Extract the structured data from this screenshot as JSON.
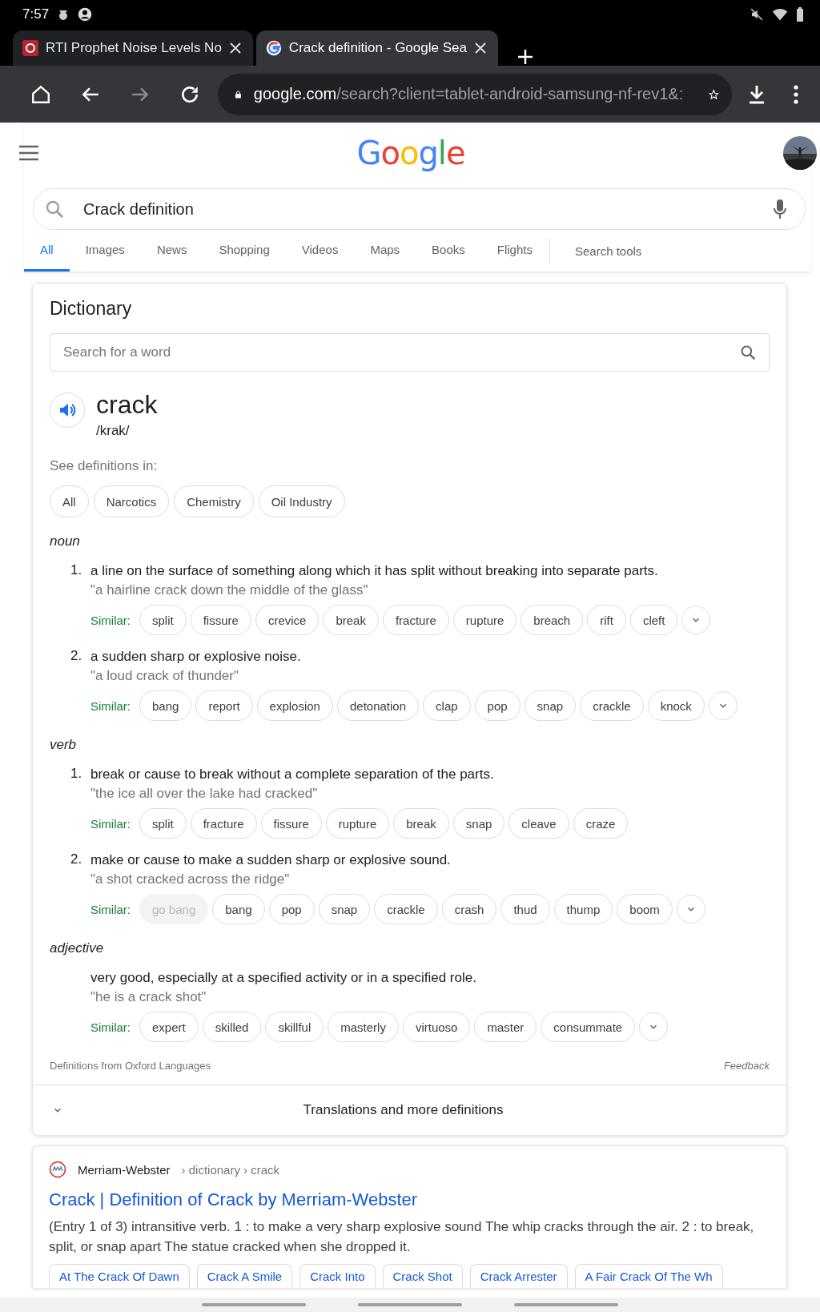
{
  "status_bar": {
    "time": "7:57"
  },
  "browser_tabs": [
    {
      "title": "RTI Prophet Noise Levels No",
      "selected": false,
      "kind": "site"
    },
    {
      "title": "Crack definition - Google Sea",
      "selected": true,
      "kind": "google"
    }
  ],
  "toolbar": {
    "url_host": "google.com",
    "url_path": "/search?client=tablet-android-samsung-nf-rev1&:",
    "forward_disabled": true
  },
  "header": {
    "logo": "Google"
  },
  "search": {
    "value": "Crack definition"
  },
  "search_tabs": [
    {
      "label": "All",
      "selected": true
    },
    {
      "label": "Images",
      "selected": false
    },
    {
      "label": "News",
      "selected": false
    },
    {
      "label": "Shopping",
      "selected": false
    },
    {
      "label": "Videos",
      "selected": false
    },
    {
      "label": "Maps",
      "selected": false
    },
    {
      "label": "Books",
      "selected": false
    },
    {
      "label": "Flights",
      "selected": false
    }
  ],
  "search_tools": "Search tools",
  "dictionary": {
    "title": "Dictionary",
    "search_placeholder": "Search for a word",
    "word": "crack",
    "phonetic": "/krak/",
    "see_in_label": "See definitions in:",
    "filters": [
      {
        "label": "All",
        "selected": false
      },
      {
        "label": "Narcotics",
        "selected": false
      },
      {
        "label": "Chemistry",
        "selected": false
      },
      {
        "label": "Oil Industry",
        "selected": false
      }
    ],
    "senses": [
      {
        "pos": "noun",
        "definitions": [
          {
            "number": "1.",
            "text": "a line on the surface of something along which it has split without breaking into separate parts.",
            "example": "\"a hairline crack down the middle of the glass\"",
            "similar_label": "Similar:",
            "similar": [
              {
                "word": "split",
                "disabled": false
              },
              {
                "word": "fissure",
                "disabled": false
              },
              {
                "word": "crevice",
                "disabled": false
              },
              {
                "word": "break",
                "disabled": false
              },
              {
                "word": "fracture",
                "disabled": false
              },
              {
                "word": "rupture",
                "disabled": false
              },
              {
                "word": "breach",
                "disabled": false
              },
              {
                "word": "rift",
                "disabled": false
              },
              {
                "word": "cleft",
                "disabled": false
              }
            ],
            "has_more": true
          },
          {
            "number": "2.",
            "text": "a sudden sharp or explosive noise.",
            "example": "\"a loud crack of thunder\"",
            "similar_label": "Similar:",
            "similar": [
              {
                "word": "bang",
                "disabled": false
              },
              {
                "word": "report",
                "disabled": false
              },
              {
                "word": "explosion",
                "disabled": false
              },
              {
                "word": "detonation",
                "disabled": false
              },
              {
                "word": "clap",
                "disabled": false
              },
              {
                "word": "pop",
                "disabled": false
              },
              {
                "word": "snap",
                "disabled": false
              },
              {
                "word": "crackle",
                "disabled": false
              },
              {
                "word": "knock",
                "disabled": false
              }
            ],
            "has_more": true
          }
        ]
      },
      {
        "pos": "verb",
        "definitions": [
          {
            "number": "1.",
            "text": "break or cause to break without a complete separation of the parts.",
            "example": "\"the ice all over the lake had cracked\"",
            "similar_label": "Similar:",
            "similar": [
              {
                "word": "split",
                "disabled": false
              },
              {
                "word": "fracture",
                "disabled": false
              },
              {
                "word": "fissure",
                "disabled": false
              },
              {
                "word": "rupture",
                "disabled": false
              },
              {
                "word": "break",
                "disabled": false
              },
              {
                "word": "snap",
                "disabled": false
              },
              {
                "word": "cleave",
                "disabled": false
              },
              {
                "word": "craze",
                "disabled": false
              }
            ],
            "has_more": false
          },
          {
            "number": "2.",
            "text": "make or cause to make a sudden sharp or explosive sound.",
            "example": "\"a shot cracked across the ridge\"",
            "similar_label": "Similar:",
            "similar": [
              {
                "word": "go bang",
                "disabled": true
              },
              {
                "word": "bang",
                "disabled": false
              },
              {
                "word": "pop",
                "disabled": false
              },
              {
                "word": "snap",
                "disabled": false
              },
              {
                "word": "crackle",
                "disabled": false
              },
              {
                "word": "crash",
                "disabled": false
              },
              {
                "word": "thud",
                "disabled": false
              },
              {
                "word": "thump",
                "disabled": false
              },
              {
                "word": "boom",
                "disabled": false
              }
            ],
            "has_more": true
          }
        ]
      },
      {
        "pos": "adjective",
        "definitions": [
          {
            "text": "very good, especially at a specified activity or in a specified role.",
            "example": "\"he is a crack shot\"",
            "similar_label": "Similar:",
            "similar": [
              {
                "word": "expert",
                "disabled": false
              },
              {
                "word": "skilled",
                "disabled": false
              },
              {
                "word": "skillful",
                "disabled": false
              },
              {
                "word": "masterly",
                "disabled": false
              },
              {
                "word": "virtuoso",
                "disabled": false
              },
              {
                "word": "master",
                "disabled": false
              },
              {
                "word": "consummate",
                "disabled": false
              }
            ],
            "has_more": true
          }
        ]
      }
    ],
    "source": "Definitions from Oxford Languages",
    "feedback": "Feedback",
    "more_label": "Translations and more definitions"
  },
  "result": {
    "site": "Merriam-Webster",
    "breadcrumb": "› dictionary › crack",
    "title": "Crack | Definition of Crack by Merriam-Webster",
    "snippet": "(Entry 1 of 3) intransitive verb. 1 : to make a very sharp explosive sound The whip cracks through the air. 2 : to break, split, or snap apart The statue cracked when she dropped it.",
    "related": [
      "At The Crack Of Dawn",
      "Crack A Smile",
      "Crack Into",
      "Crack Shot",
      "Crack Arrester",
      "A Fair Crack Of The Wh"
    ]
  }
}
